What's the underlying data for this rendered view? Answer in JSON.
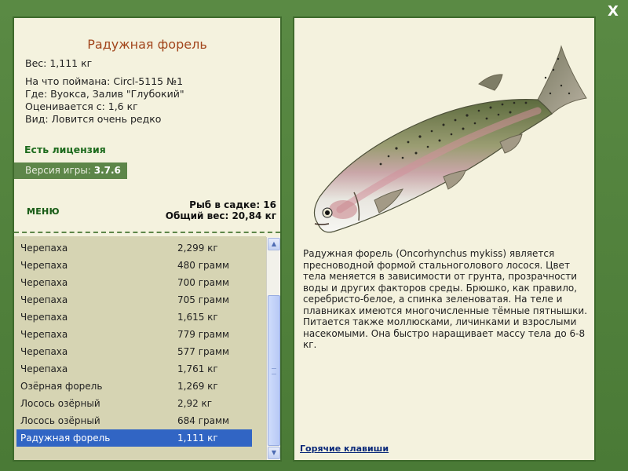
{
  "window": {
    "close_label": "X"
  },
  "fish_info": {
    "title": "Радужная форель",
    "weight": "Вес: 1,111 кг",
    "caught_with": "На что поймана: Circl-5115 №1",
    "where": "Где: Вуокса, Залив \"Глубокий\"",
    "valued_from": "Оценивается с: 1,6 кг",
    "rarity": "Вид: Ловится очень редко",
    "license": "Есть лицензия"
  },
  "version": {
    "label": "Версия игры: ",
    "value": "3.7.6"
  },
  "menu": {
    "label": "МЕНЮ"
  },
  "cage": {
    "fish_count": "Рыб в садке: 16",
    "total_weight": "Общий вес: 20,84 кг"
  },
  "catch_list": [
    {
      "name": "Черепаха",
      "weight": "2,299 кг"
    },
    {
      "name": "Черепаха",
      "weight": "480 грамм"
    },
    {
      "name": "Черепаха",
      "weight": "700 грамм"
    },
    {
      "name": "Черепаха",
      "weight": "705 грамм"
    },
    {
      "name": "Черепаха",
      "weight": "1,615 кг"
    },
    {
      "name": "Черепаха",
      "weight": "779 грамм"
    },
    {
      "name": "Черепаха",
      "weight": "577 грамм"
    },
    {
      "name": "Черепаха",
      "weight": "1,761 кг"
    },
    {
      "name": "Озёрная форель",
      "weight": "1,269 кг"
    },
    {
      "name": "Лосось озёрный",
      "weight": "2,92 кг"
    },
    {
      "name": "Лосось озёрный",
      "weight": "684 грамм"
    },
    {
      "name": "Радужная форель",
      "weight": "1,111 кг",
      "selected": true
    }
  ],
  "description": "Радужная форель (Oncorhynchus mykiss) является пресноводной формой стальноголового лосося. Цвет тела меняется в зависимости от грунта, прозрачности воды и других факторов среды. Брюшко, как правило, серебристо-белое, а спинка зеленоватая. На теле и плавниках имеются многочисленные тёмные пятнышки. Питается также моллюсками, личинками и взрослыми насекомыми. Она быстро наращивает массу тела до 6-8 кг.",
  "hotkeys_label": "Горячие клавиши",
  "icons": {
    "close": "close-icon",
    "scroll_up": "chevron-up-icon",
    "scroll_down": "chevron-down-icon",
    "fish_picture": "rainbow-trout-image"
  },
  "colors": {
    "frame_green": "#4f7f3a",
    "panel_bg": "#f4f2de",
    "title_brown": "#a2461c",
    "license_green": "#1d6b1d",
    "selection_blue": "#3165c4",
    "list_bg": "#d6d4b3"
  }
}
